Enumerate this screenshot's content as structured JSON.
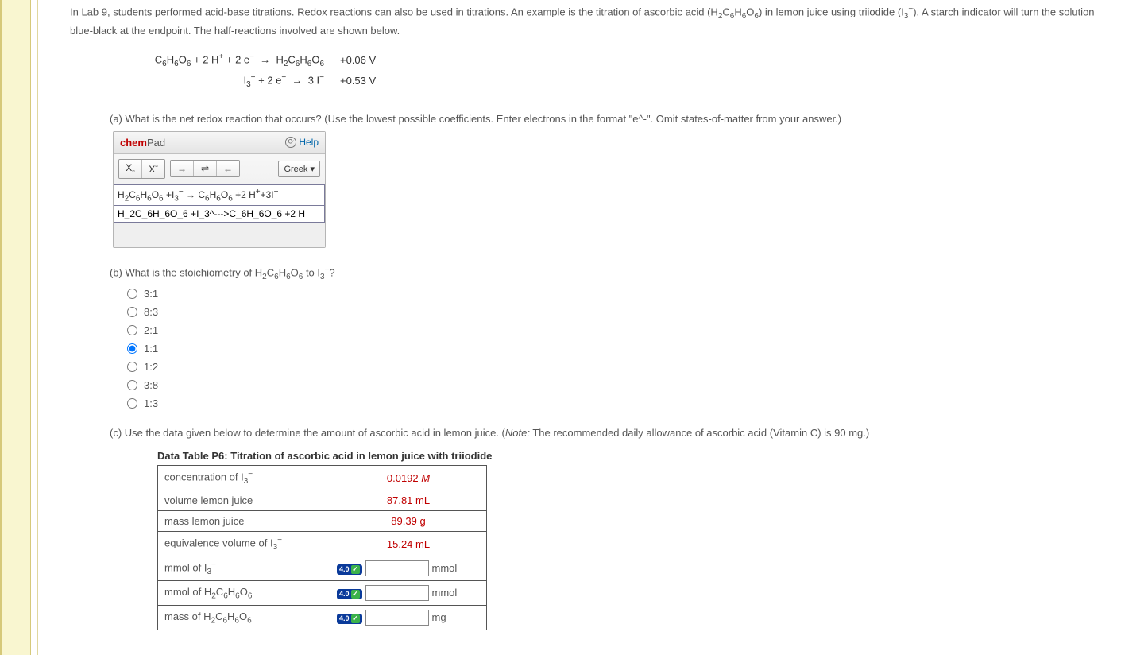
{
  "intro": {
    "line1_pre": "In Lab 9, students performed acid-base titrations. Redox reactions can also be used in titrations. An example is the titration of ascorbic acid (H",
    "line1_post": ") in lemon juice using triiodide (I",
    "line1_end": "). A starch indicator will turn the solution blue-black at the endpoint. The half-reactions involved are shown below."
  },
  "eq": {
    "v1": "+0.06 V",
    "v2": "+0.53 V"
  },
  "partA": {
    "text": "(a) What is the net redox reaction that occurs? (Use the lowest possible coefficients. Enter electrons in the format \"e^-\". Omit states-of-matter from your answer.)"
  },
  "chempad": {
    "title_chem": "chem",
    "title_pad": "Pad",
    "help": "Help",
    "greek": "Greek ▾",
    "raw": "H_2C_6H_6O_6 +I_3^--->C_6H_6O_6 +2 H"
  },
  "partB": {
    "text_pre": "(b) What is the stoichiometry of H",
    "text_mid": " to I",
    "text_post": "?",
    "options": [
      "3:1",
      "8:3",
      "2:1",
      "1:1",
      "1:2",
      "3:8",
      "1:3"
    ],
    "selected": "1:1"
  },
  "partC": {
    "text_pre": "(c) Use the data given below to determine the amount of ascorbic acid in lemon juice. (",
    "note_label": "Note:",
    "text_post": " The recommended daily allowance of ascorbic acid (Vitamin C) is 90 mg.)"
  },
  "table": {
    "title": "Data Table P6: Titration of ascorbic acid in lemon juice with triiodide",
    "rows_given": [
      {
        "label_pre": "concentration of I",
        "label_sub": "3",
        "label_sup": "−",
        "value": "0.0192",
        "unit": "M",
        "unit_italic": true
      },
      {
        "label": "volume lemon juice",
        "value": "87.81",
        "unit": "mL"
      },
      {
        "label": "mass lemon juice",
        "value": "89.39",
        "unit": "g"
      },
      {
        "label_pre": "equivalence volume of I",
        "label_sub": "3",
        "label_sup": "−",
        "value": "15.24",
        "unit": "mL"
      }
    ],
    "rows_input": [
      {
        "label_pre": "mmol of I",
        "label_sub": "3",
        "label_sup": "−",
        "unit": "mmol",
        "badge": "4.0"
      },
      {
        "label_pre": "mmol of H",
        "chem": "2C6H6O6",
        "unit": "mmol",
        "badge": "4.0"
      },
      {
        "label_pre": "mass of H",
        "chem": "2C6H6O6",
        "unit": "mg",
        "badge": "4.0"
      }
    ]
  }
}
